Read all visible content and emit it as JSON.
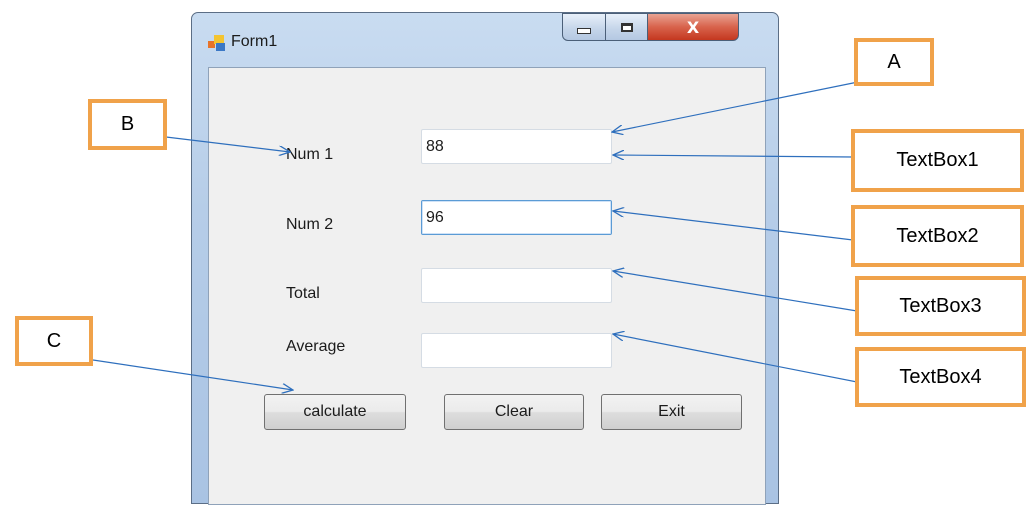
{
  "window": {
    "title": "Form1",
    "controls": {
      "minimize_icon": "minimize-icon",
      "maximize_icon": "maximize-icon",
      "close_label": "X"
    },
    "colors": {
      "title_bg": "#b6cde8",
      "close_bg": "#c4371f"
    }
  },
  "form": {
    "num1": {
      "label": "Num 1",
      "value": "88"
    },
    "num2": {
      "label": "Num 2",
      "value": "96"
    },
    "total": {
      "label": "Total",
      "value": ""
    },
    "average": {
      "label": "Average",
      "value": ""
    },
    "buttons": {
      "calculate": "calculate",
      "clear": "Clear",
      "exit": "Exit"
    }
  },
  "callouts": {
    "a": "A",
    "b": "B",
    "c": "C",
    "textbox1": "TextBox1",
    "textbox2": "TextBox2",
    "textbox3": "TextBox3",
    "textbox4": "TextBox4",
    "accent": "#f0a24a",
    "arrow_color": "#2e6fbd"
  }
}
